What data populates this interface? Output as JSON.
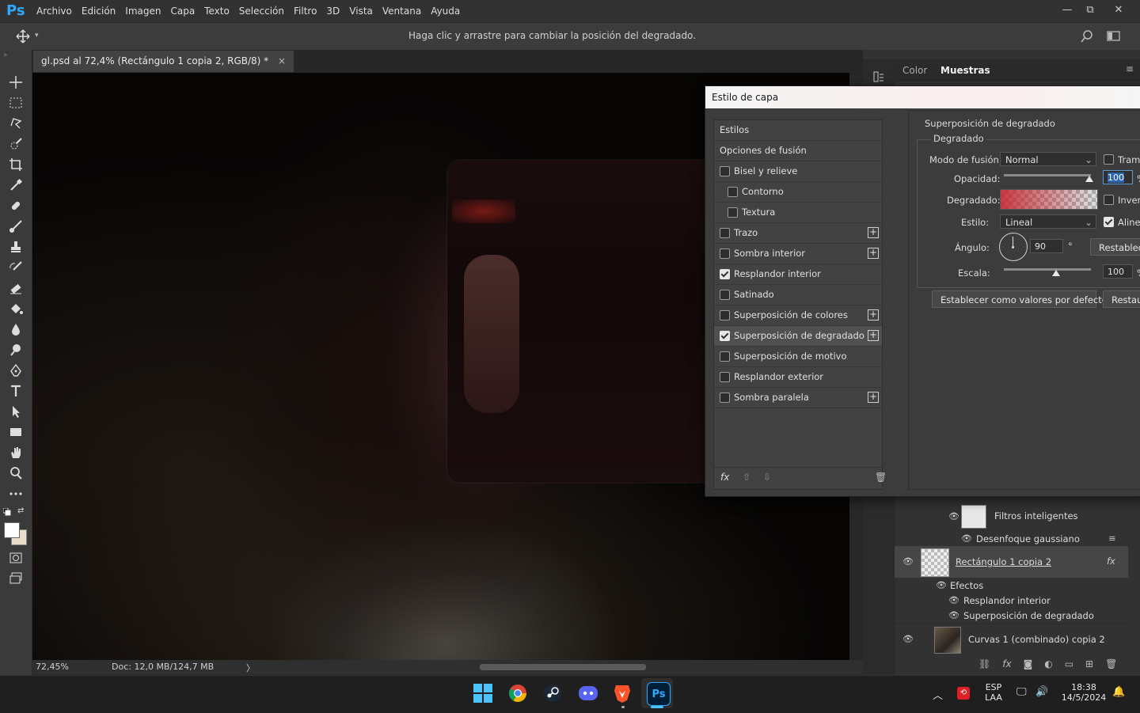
{
  "app": {
    "logo": "Ps"
  },
  "menu": [
    "Archivo",
    "Edición",
    "Imagen",
    "Capa",
    "Texto",
    "Selección",
    "Filtro",
    "3D",
    "Vista",
    "Ventana",
    "Ayuda"
  ],
  "window_controls": {
    "minimize": "—",
    "restore": "⧉",
    "close": "✕"
  },
  "options_bar": {
    "hint": "Haga clic y arrastre para cambiar la posición del degradado."
  },
  "document_tab": {
    "title": "gl.psd al 72,4% (Rectángulo 1 copia 2, RGB/8) *",
    "close": "×"
  },
  "status": {
    "zoom": "72,45%",
    "doc": "Doc: 12,0 MB/124,7 MB",
    "arrow": "〉"
  },
  "right_panel": {
    "tabs": [
      "Color",
      "Muestras"
    ]
  },
  "dialog": {
    "title": "Estilo de capa",
    "styles_header": "Estilos",
    "blend_options": "Opciones de fusión",
    "styles": [
      {
        "label": "Bisel y relieve",
        "checked": false,
        "plus": false,
        "indent": false
      },
      {
        "label": "Contorno",
        "checked": false,
        "plus": false,
        "indent": true
      },
      {
        "label": "Textura",
        "checked": false,
        "plus": false,
        "indent": true
      },
      {
        "label": "Trazo",
        "checked": false,
        "plus": true,
        "indent": false
      },
      {
        "label": "Sombra interior",
        "checked": false,
        "plus": true,
        "indent": false
      },
      {
        "label": "Resplandor interior",
        "checked": true,
        "plus": false,
        "indent": false
      },
      {
        "label": "Satinado",
        "checked": false,
        "plus": false,
        "indent": false
      },
      {
        "label": "Superposición de colores",
        "checked": false,
        "plus": true,
        "indent": false
      },
      {
        "label": "Superposición de degradado",
        "checked": true,
        "plus": true,
        "indent": false,
        "selected": true
      },
      {
        "label": "Superposición de motivo",
        "checked": false,
        "plus": false,
        "indent": false
      },
      {
        "label": "Resplandor exterior",
        "checked": false,
        "plus": false,
        "indent": false
      },
      {
        "label": "Sombra paralela",
        "checked": false,
        "plus": true,
        "indent": false
      }
    ],
    "footer": {
      "fx": "fx",
      "up": "⇧",
      "down": "⇩",
      "trash": "🗑"
    },
    "gradient_overlay": {
      "section_title": "Superposición de degradado",
      "group_title": "Degradado",
      "blend_mode_label": "Modo de fusión:",
      "blend_mode_value": "Normal",
      "dither_label": "Trama",
      "opacity_label": "Opacidad:",
      "opacity_value": "100",
      "opacity_unit": "%",
      "gradient_label": "Degradado:",
      "reverse_label": "Inver",
      "style_label": "Estilo:",
      "style_value": "Lineal",
      "align_label": "Alinea",
      "angle_label": "Ángulo:",
      "angle_value": "90",
      "angle_unit": "°",
      "reset_align": "Restablece",
      "scale_label": "Escala:",
      "scale_value": "100",
      "scale_unit": "%",
      "make_default": "Establecer como valores por defecto",
      "reset_default": "Restaur"
    }
  },
  "layers": {
    "smart_filters": "Filtros inteligentes",
    "gaussian_blur": "Desenfoque gaussiano",
    "rect_layer": "Rectángulo 1 copia 2",
    "rect_fx": "fx",
    "effects": "Efectos",
    "effect_items": [
      "Resplandor interior",
      "Superposición de degradado"
    ],
    "curves_layer": "Curvas 1 (combinado) copia 2"
  },
  "taskbar": {
    "lang_top": "ESP",
    "lang_bottom": "LAA",
    "time": "18:38",
    "date": "14/5/2024",
    "ps_label": "Ps"
  },
  "colors": {
    "accent_blue": "#31a8ff",
    "dialog_bg": "#3c3c3c"
  }
}
